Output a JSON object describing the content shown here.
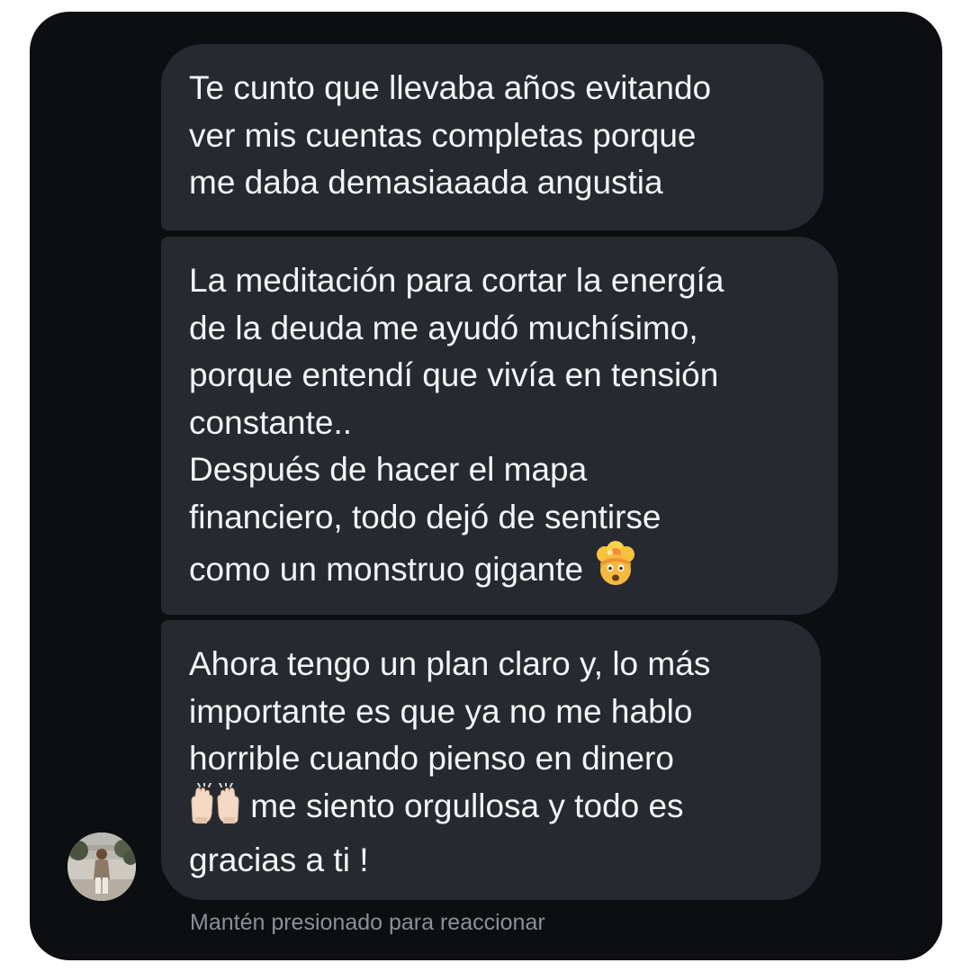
{
  "conversation": {
    "messages": [
      {
        "lines": [
          "Te cunto que llevaba años evitando",
          "ver mis cuentas completas porque",
          "me daba demasiaaada angustia"
        ]
      },
      {
        "lines": [
          "La meditación para cortar la energía",
          "de la deuda me ayudó muchísimo,",
          "porque entendí que vivía en tensión",
          "constante..",
          "Después de hacer el mapa",
          "financiero, todo dejó de sentirse",
          "como un monstruo gigante"
        ],
        "emoji": "exploding-head-icon"
      },
      {
        "lines": [
          "Ahora tengo un plan claro y, lo más",
          "importante es que ya no me hablo",
          "horrible cuando pienso en dinero",
          " me siento orgullosa y todo es",
          "gracias a ti !"
        ],
        "emoji": "raising-hands-icon"
      }
    ],
    "hint": "Mantén presionado para reaccionar"
  },
  "colors": {
    "card_background": "#0c0e11",
    "bubble_background": "#262a30",
    "message_text": "#f3f4f6",
    "hint_text": "#8b9098"
  }
}
